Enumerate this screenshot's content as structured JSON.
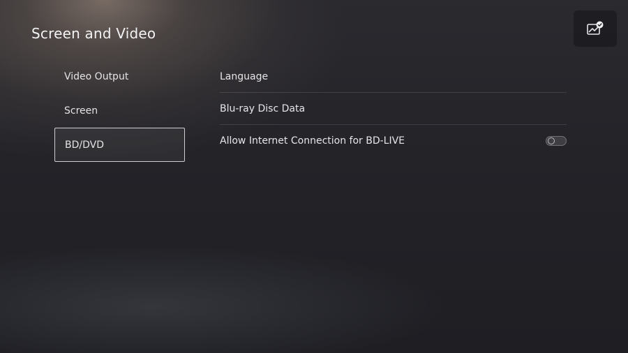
{
  "header": {
    "title": "Screen and Video",
    "corner_button_icon": "image-check-icon"
  },
  "sidebar": {
    "items": [
      {
        "label": "Video Output",
        "selected": false
      },
      {
        "label": "Screen",
        "selected": false
      },
      {
        "label": "BD/DVD",
        "selected": true
      }
    ]
  },
  "settings": {
    "rows": [
      {
        "label": "Language"
      },
      {
        "label": "Blu-ray Disc Data"
      },
      {
        "label": "Allow Internet Connection for BD-LIVE",
        "toggle_on": false
      }
    ]
  },
  "colors": {
    "background": "#1f1f24",
    "text": "#e8e8ea",
    "selection_border": "#cfcfd3"
  }
}
